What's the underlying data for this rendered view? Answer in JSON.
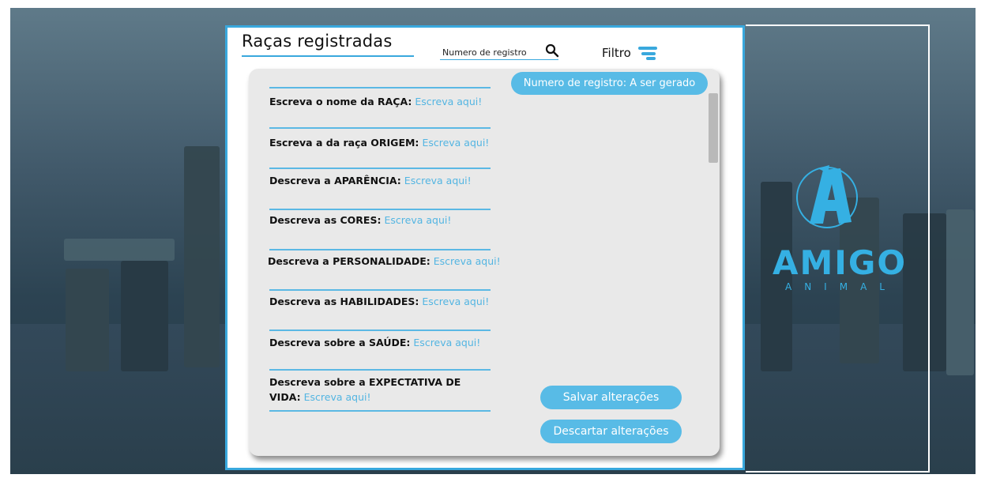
{
  "header": {
    "title": "Raças registradas",
    "search_placeholder": "Numero de registro",
    "search_icon": "search-icon",
    "filter_label": "Filtro",
    "filter_icon": "filter-icon"
  },
  "form": {
    "registration_badge": "Numero de registro: A ser gerado",
    "fields": [
      {
        "label": "Escreva o nome da RAÇA:",
        "placeholder": "Escreva aqui!"
      },
      {
        "label": "Escreva a da raça ORIGEM:",
        "placeholder": "Escreva aqui!"
      },
      {
        "label": "Descreva a APARÊNCIA:",
        "placeholder": "Escreva aqui!"
      },
      {
        "label": "Descreva as CORES:",
        "placeholder": "Escreva aqui!"
      },
      {
        "label": "Descreva a PERSONALIDADE:",
        "placeholder": "Escreva aqui!"
      },
      {
        "label": "Descreva as HABILIDADES:",
        "placeholder": "Escreva aqui!"
      },
      {
        "label": "Descreva sobre a SAÚDE:",
        "placeholder": "Escreva aqui!"
      },
      {
        "label_line1": "Descreva sobre a EXPECTATIVA DE",
        "label_line2": "VIDA:",
        "placeholder": "Escreva aqui!"
      }
    ],
    "save_button": "Salvar alterações",
    "discard_button": "Descartar alterações"
  },
  "logo": {
    "letter": "A",
    "name": "AMIGO",
    "subtitle": "ANIMAL",
    "color": "#35b0e3"
  },
  "colors": {
    "accent": "#39a8dd",
    "pill": "#58bbe6",
    "card": "#e9e9e9"
  }
}
